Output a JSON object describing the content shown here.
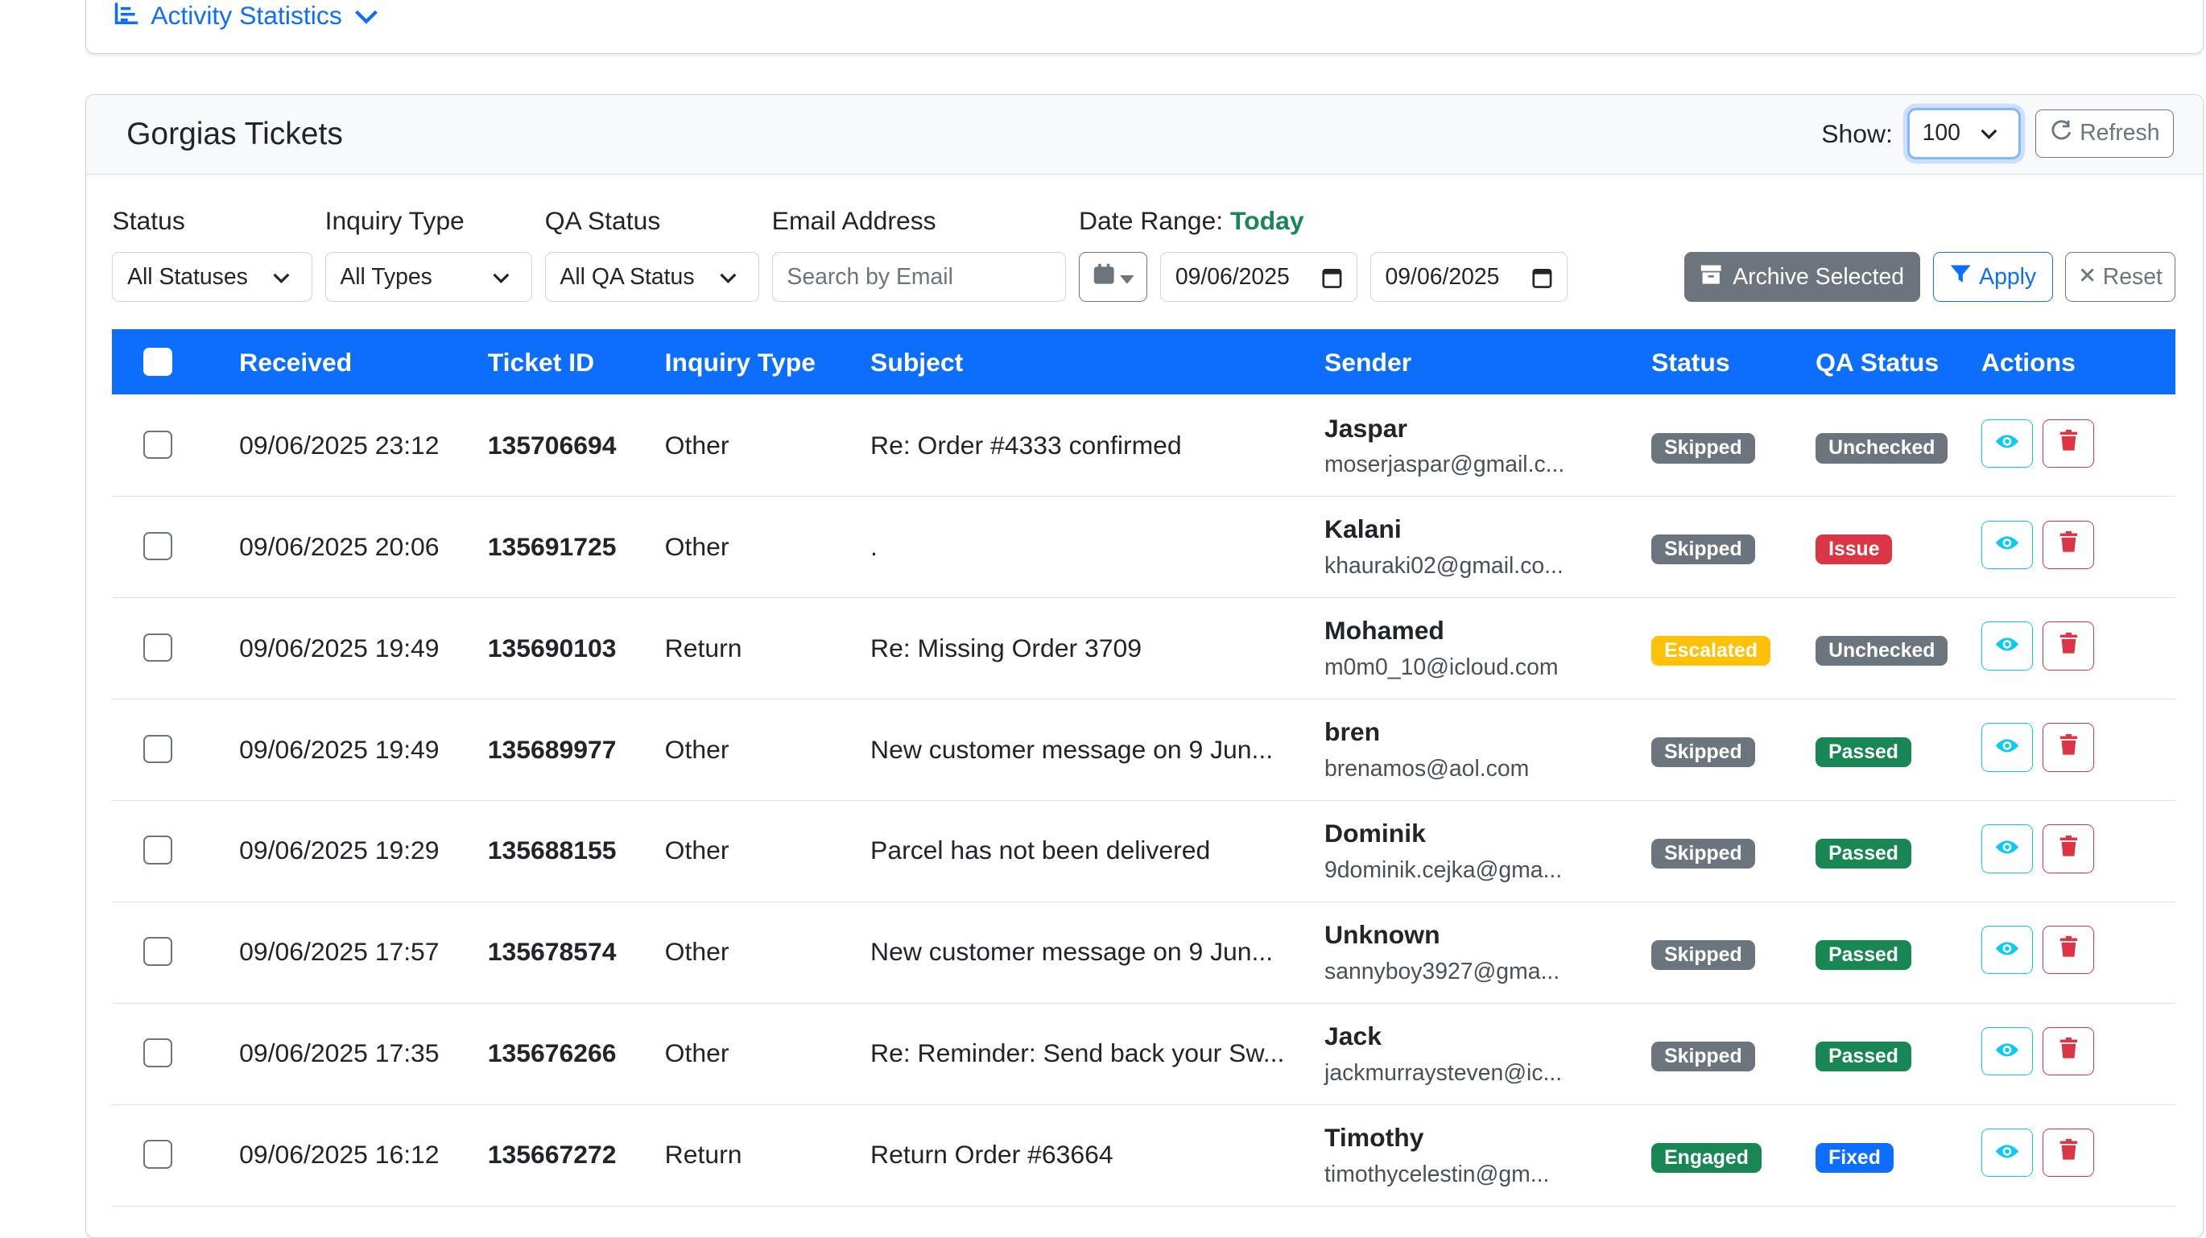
{
  "stats": {
    "label": "Activity Statistics"
  },
  "header": {
    "title": "Gorgias Tickets",
    "show_label": "Show:",
    "show_value": "100",
    "refresh_label": "Refresh"
  },
  "filters": {
    "status_label": "Status",
    "status_value": "All Statuses",
    "inquiry_label": "Inquiry Type",
    "inquiry_value": "All Types",
    "qa_label": "QA Status",
    "qa_value": "All QA Status",
    "email_label": "Email Address",
    "email_placeholder": "Search by Email",
    "date_label": "Date Range:",
    "date_highlight": "Today",
    "date_from": "09/06/2025",
    "date_to": "09/06/2025",
    "archive_label": "Archive Selected",
    "apply_label": "Apply",
    "reset_label": "Reset"
  },
  "table": {
    "headers": [
      "Received",
      "Ticket ID",
      "Inquiry Type",
      "Subject",
      "Sender",
      "Status",
      "QA Status",
      "Actions"
    ],
    "rows": [
      {
        "received": "09/06/2025 23:12",
        "ticket_id": "135706694",
        "inquiry": "Other",
        "subject": "Re: Order #4333 confirmed",
        "sender_name": "Jaspar",
        "sender_email": "moserjaspar@gmail.c...",
        "status": "Skipped",
        "qa_status": "Unchecked"
      },
      {
        "received": "09/06/2025 20:06",
        "ticket_id": "135691725",
        "inquiry": "Other",
        "subject": ".",
        "sender_name": "Kalani",
        "sender_email": "khauraki02@gmail.co...",
        "status": "Skipped",
        "qa_status": "Issue"
      },
      {
        "received": "09/06/2025 19:49",
        "ticket_id": "135690103",
        "inquiry": "Return",
        "subject": "Re: Missing Order 3709",
        "sender_name": "Mohamed",
        "sender_email": "m0m0_10@icloud.com",
        "status": "Escalated",
        "qa_status": "Unchecked"
      },
      {
        "received": "09/06/2025 19:49",
        "ticket_id": "135689977",
        "inquiry": "Other",
        "subject": "New customer message on 9 Jun...",
        "sender_name": "bren",
        "sender_email": "brenamos@aol.com",
        "status": "Skipped",
        "qa_status": "Passed"
      },
      {
        "received": "09/06/2025 19:29",
        "ticket_id": "135688155",
        "inquiry": "Other",
        "subject": "Parcel has not been delivered",
        "sender_name": "Dominik",
        "sender_email": "9dominik.cejka@gma...",
        "status": "Skipped",
        "qa_status": "Passed"
      },
      {
        "received": "09/06/2025 17:57",
        "ticket_id": "135678574",
        "inquiry": "Other",
        "subject": "New customer message on 9 Jun...",
        "sender_name": "Unknown",
        "sender_email": "sannyboy3927@gma...",
        "status": "Skipped",
        "qa_status": "Passed"
      },
      {
        "received": "09/06/2025 17:35",
        "ticket_id": "135676266",
        "inquiry": "Other",
        "subject": "Re: Reminder: Send back your Sw...",
        "sender_name": "Jack",
        "sender_email": "jackmurraysteven@ic...",
        "status": "Skipped",
        "qa_status": "Passed"
      },
      {
        "received": "09/06/2025 16:12",
        "ticket_id": "135667272",
        "inquiry": "Return",
        "subject": "Return Order #63664",
        "sender_name": "Timothy",
        "sender_email": "timothycelestin@gm...",
        "status": "Engaged",
        "qa_status": "Fixed"
      }
    ]
  },
  "colors": {
    "primary": "#0d6efd",
    "skipped": "#6c757d",
    "escalated": "#ffc107",
    "engaged": "#198754",
    "unchecked": "#6c757d",
    "issue": "#dc3545",
    "passed": "#198754",
    "fixed": "#0d6efd"
  },
  "icons": {
    "stats": "bar-chart-icon",
    "refresh": "refresh-icon",
    "calendar": "calendar-icon",
    "archive": "archive-icon",
    "apply": "filter-icon",
    "reset": "close-icon",
    "view": "eye-icon",
    "delete": "trash-icon"
  }
}
